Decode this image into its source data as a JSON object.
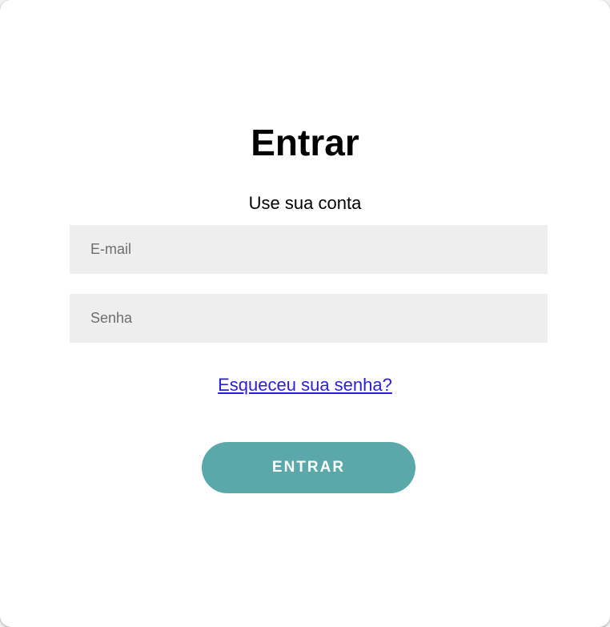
{
  "login": {
    "title": "Entrar",
    "subtitle": "Use sua conta",
    "email_placeholder": "E-mail",
    "password_placeholder": "Senha",
    "forgot_link": "Esqueceu sua senha?",
    "submit_label": "ENTRAR"
  },
  "colors": {
    "button_background": "#5aa8aa",
    "input_background": "#eeeeee",
    "link": "#2a1fd9"
  }
}
